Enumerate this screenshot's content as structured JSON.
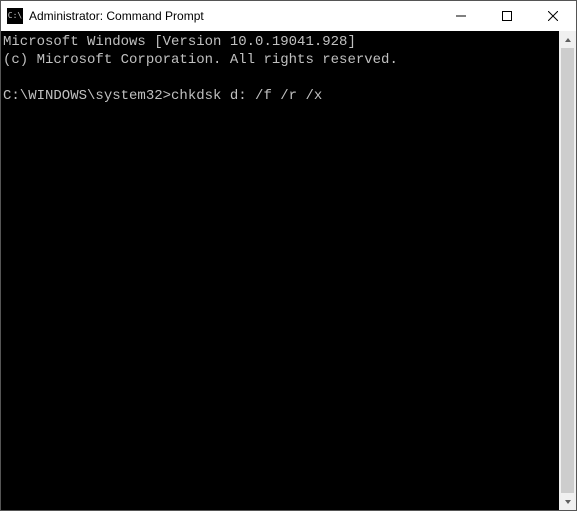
{
  "titlebar": {
    "icon_label": "C:\\",
    "title": "Administrator: Command Prompt"
  },
  "controls": {
    "minimize_tooltip": "Minimize",
    "maximize_tooltip": "Maximize",
    "close_tooltip": "Close"
  },
  "terminal": {
    "line1": "Microsoft Windows [Version 10.0.19041.928]",
    "line2": "(c) Microsoft Corporation. All rights reserved.",
    "blank": "",
    "prompt_path": "C:\\WINDOWS\\system32>",
    "command": "chkdsk d: /f /r /x"
  }
}
